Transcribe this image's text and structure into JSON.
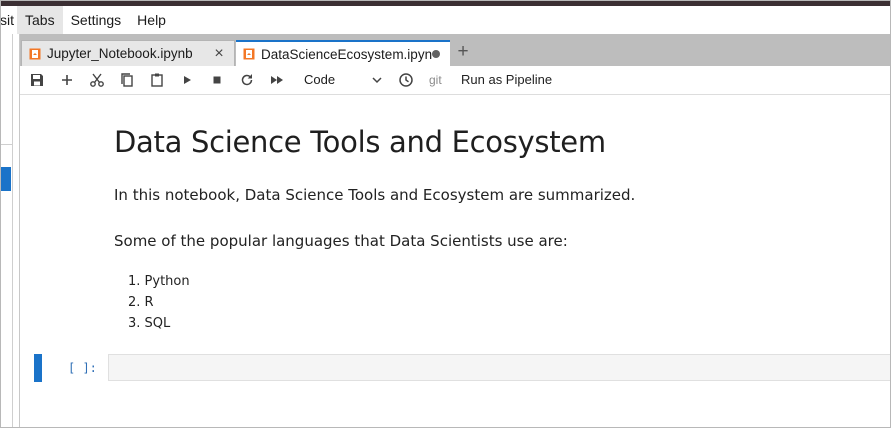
{
  "menubar": {
    "items": [
      {
        "label": "sit"
      },
      {
        "label": "Tabs"
      },
      {
        "label": "Settings"
      },
      {
        "label": "Help"
      }
    ]
  },
  "tabs": [
    {
      "label": "Jupyter_Notebook.ipynb",
      "icon": "notebook-icon"
    },
    {
      "label": "DataScienceEcosystem.ipyn",
      "icon": "notebook-icon",
      "unsaved": true
    }
  ],
  "toolbar": {
    "cell_type": "Code",
    "git_label": "git",
    "pipeline_label": "Run as Pipeline",
    "icons": [
      "save-icon",
      "add-icon",
      "cut-icon",
      "copy-icon",
      "paste-icon",
      "run-icon",
      "stop-icon",
      "restart-icon",
      "fast-forward-icon",
      "clock-icon"
    ]
  },
  "notebook": {
    "title": "Data Science Tools and Ecosystem",
    "intro": "In this notebook, Data Science Tools and Ecosystem are summarized.",
    "languages_intro": "Some of the popular languages that Data Scientists use are:",
    "languages": [
      {
        "marker": "1.",
        "name": "Python"
      },
      {
        "marker": "2.",
        "name": "R"
      },
      {
        "marker": "3.",
        "name": "SQL"
      }
    ],
    "code_cell": {
      "prompt": "[ ]:",
      "source": ""
    }
  },
  "colors": {
    "accent": "#1a73c9",
    "notebook_icon": "#f37726",
    "tabbar_bg": "#bdbdbd"
  }
}
